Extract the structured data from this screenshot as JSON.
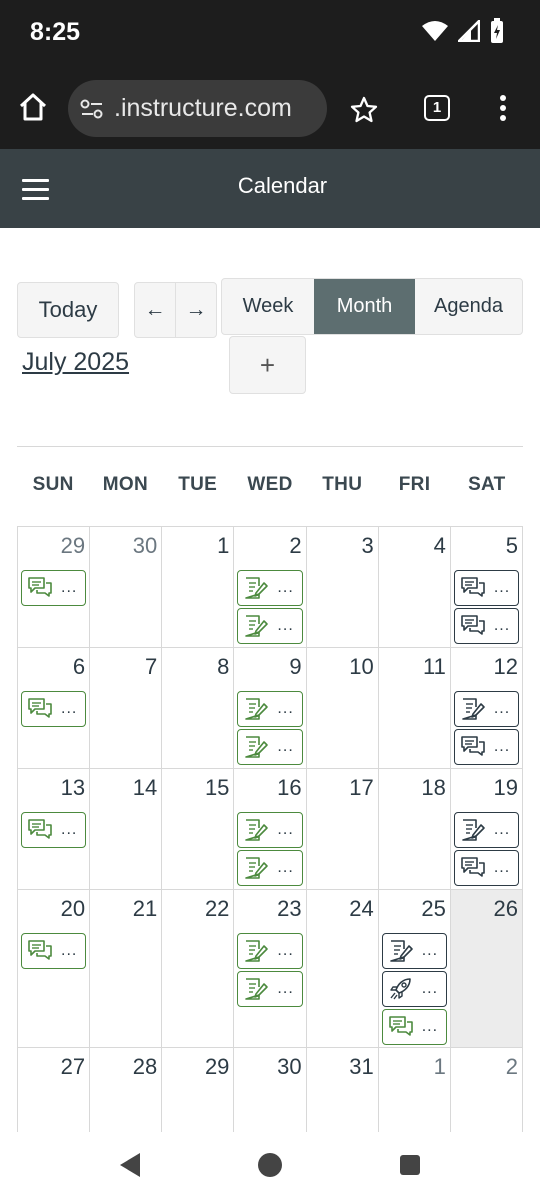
{
  "status": {
    "time": "8:25"
  },
  "browser": {
    "url": ".instructure.com",
    "tab_count": "1"
  },
  "app": {
    "title": "Calendar"
  },
  "toolbar": {
    "today_label": "Today",
    "prev_label": "←",
    "next_label": "→",
    "views": [
      "Week",
      "Month",
      "Agenda"
    ],
    "selected_view": "Month",
    "month_title": "July 2025",
    "add_label": "+"
  },
  "weekdays": [
    "SUN",
    "MON",
    "TUE",
    "WED",
    "THU",
    "FRI",
    "SAT"
  ],
  "weeks": [
    [
      {
        "day": "29",
        "other": true,
        "events": [
          {
            "icon": "discussion",
            "color": "green"
          }
        ]
      },
      {
        "day": "30",
        "other": true,
        "events": []
      },
      {
        "day": "1",
        "events": []
      },
      {
        "day": "2",
        "events": [
          {
            "icon": "assignment",
            "color": "green"
          },
          {
            "icon": "assignment",
            "color": "green"
          }
        ]
      },
      {
        "day": "3",
        "events": []
      },
      {
        "day": "4",
        "events": []
      },
      {
        "day": "5",
        "events": [
          {
            "icon": "discussion",
            "color": "dark"
          },
          {
            "icon": "discussion",
            "color": "dark"
          }
        ]
      }
    ],
    [
      {
        "day": "6",
        "events": [
          {
            "icon": "discussion",
            "color": "green"
          }
        ]
      },
      {
        "day": "7",
        "events": []
      },
      {
        "day": "8",
        "events": []
      },
      {
        "day": "9",
        "events": [
          {
            "icon": "assignment",
            "color": "green"
          },
          {
            "icon": "assignment",
            "color": "green"
          }
        ]
      },
      {
        "day": "10",
        "events": []
      },
      {
        "day": "11",
        "events": []
      },
      {
        "day": "12",
        "events": [
          {
            "icon": "assignment",
            "color": "dark"
          },
          {
            "icon": "discussion",
            "color": "dark"
          }
        ]
      }
    ],
    [
      {
        "day": "13",
        "events": [
          {
            "icon": "discussion",
            "color": "green"
          }
        ]
      },
      {
        "day": "14",
        "events": []
      },
      {
        "day": "15",
        "events": []
      },
      {
        "day": "16",
        "events": [
          {
            "icon": "assignment",
            "color": "green"
          },
          {
            "icon": "assignment",
            "color": "green"
          }
        ]
      },
      {
        "day": "17",
        "events": []
      },
      {
        "day": "18",
        "events": []
      },
      {
        "day": "19",
        "events": [
          {
            "icon": "assignment",
            "color": "dark"
          },
          {
            "icon": "discussion",
            "color": "dark"
          }
        ]
      }
    ],
    [
      {
        "day": "20",
        "events": [
          {
            "icon": "discussion",
            "color": "green"
          }
        ]
      },
      {
        "day": "21",
        "events": []
      },
      {
        "day": "22",
        "events": []
      },
      {
        "day": "23",
        "events": [
          {
            "icon": "assignment",
            "color": "green"
          },
          {
            "icon": "assignment",
            "color": "green"
          }
        ]
      },
      {
        "day": "24",
        "events": []
      },
      {
        "day": "25",
        "events": [
          {
            "icon": "assignment",
            "color": "dark"
          },
          {
            "icon": "rocket",
            "color": "dark"
          },
          {
            "icon": "discussion",
            "color": "green"
          }
        ]
      },
      {
        "day": "26",
        "today": true,
        "events": []
      }
    ],
    [
      {
        "day": "27",
        "events": []
      },
      {
        "day": "28",
        "events": []
      },
      {
        "day": "29",
        "events": []
      },
      {
        "day": "30",
        "events": []
      },
      {
        "day": "31",
        "events": []
      },
      {
        "day": "1",
        "other": true,
        "events": []
      },
      {
        "day": "2",
        "other": true,
        "events": []
      }
    ]
  ],
  "event_ellipsis": "...",
  "colors": {
    "green": "#4c8a3e",
    "dark": "#2d3b45",
    "active_view": "#5d6e70",
    "app_bar": "#394246"
  }
}
